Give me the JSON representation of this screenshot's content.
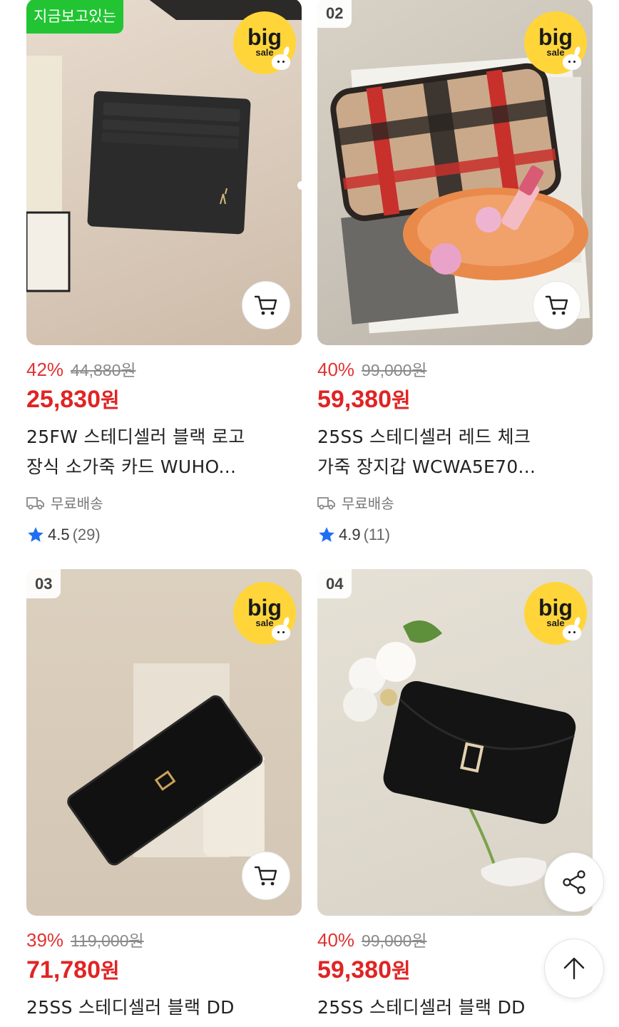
{
  "now_viewing_label": "지금보고있는",
  "badge": {
    "big": "big",
    "sale": "sale"
  },
  "free_shipping_label": "무료배송",
  "products": [
    {
      "rank": "",
      "discount": "42%",
      "original_price": "44,880원",
      "price_number": "25,830",
      "price_unit": "원",
      "title_line1": "25FW 스테디셀러 블랙 로고",
      "title_line2": "장식 소가죽 카드  WUHO...",
      "rating": "4.5",
      "review_count": "(29)"
    },
    {
      "rank": "02",
      "discount": "40%",
      "original_price": "99,000원",
      "price_number": "59,380",
      "price_unit": "원",
      "title_line1": "25SS 스테디셀러 레드 체크",
      "title_line2": "가죽 장지갑 WCWA5E70...",
      "rating": "4.9",
      "review_count": "(11)"
    },
    {
      "rank": "03",
      "discount": "39%",
      "original_price": "119,000원",
      "price_number": "71,780",
      "price_unit": "원",
      "title_line1": "25SS 스테디셀러 블랙 DD"
    },
    {
      "rank": "04",
      "discount": "40%",
      "original_price": "99,000원",
      "price_number": "59,380",
      "price_unit": "원",
      "title_line1": "25SS 스테디셀러 블랙 DD"
    }
  ],
  "icons": {
    "cart": "cart-icon",
    "truck": "truck-icon",
    "star": "star-icon",
    "share": "share-icon",
    "arrow_up": "arrow-up-icon"
  },
  "colors": {
    "discount_red": "#e02424",
    "now_green": "#22c433",
    "badge_yellow": "#ffd53a",
    "star_blue": "#1f6ff2"
  }
}
